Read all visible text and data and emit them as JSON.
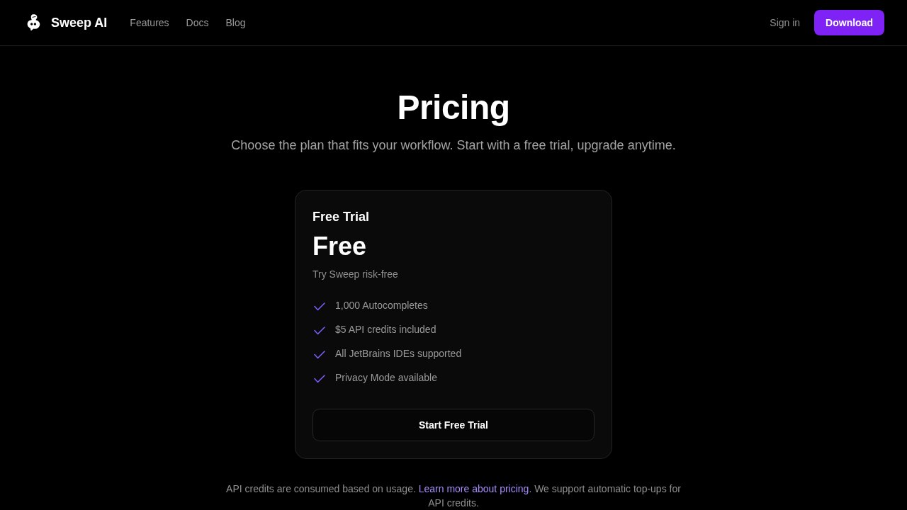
{
  "header": {
    "brand": "Sweep AI",
    "nav": [
      "Features",
      "Docs",
      "Blog"
    ],
    "sign_in": "Sign in",
    "download": "Download"
  },
  "hero": {
    "title": "Pricing",
    "subtitle": "Choose the plan that fits your workflow. Start with a free trial, upgrade anytime."
  },
  "plan": {
    "name": "Free Trial",
    "price": "Free",
    "tagline": "Try Sweep risk-free",
    "features": [
      "1,000 Autocompletes",
      "$5 API credits included",
      "All JetBrains IDEs supported",
      "Privacy Mode available"
    ],
    "button": "Start Free Trial"
  },
  "footnote": {
    "before": "API credits are consumed based on usage.",
    "link": "Learn more about pricing",
    "after": ". We support automatic top-ups for API credits."
  }
}
